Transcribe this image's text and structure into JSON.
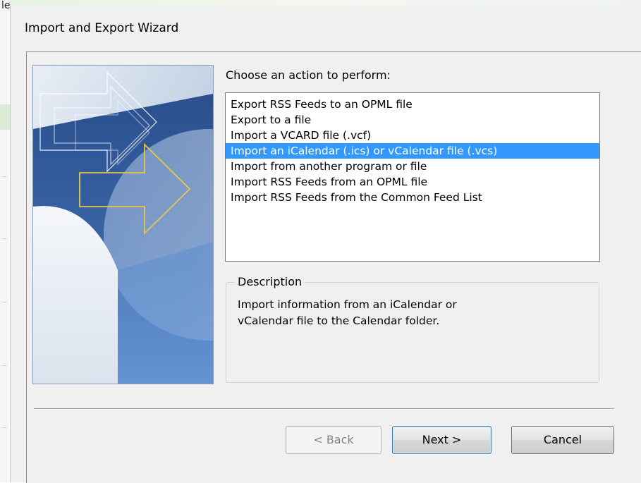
{
  "background_app": {
    "title_fragment": "le"
  },
  "dialog": {
    "title": "Import and Export Wizard",
    "prompt": "Choose an action to perform:",
    "actions": [
      {
        "label": "Export RSS Feeds to an OPML file",
        "selected": false
      },
      {
        "label": "Export to a file",
        "selected": false
      },
      {
        "label": "Import a VCARD file (.vcf)",
        "selected": false
      },
      {
        "label": "Import an iCalendar (.ics) or vCalendar file (.vcs)",
        "selected": true
      },
      {
        "label": "Import from another program or file",
        "selected": false
      },
      {
        "label": "Import RSS Feeds from an OPML file",
        "selected": false
      },
      {
        "label": "Import RSS Feeds from the Common Feed List",
        "selected": false
      }
    ],
    "description": {
      "legend": "Description",
      "text_line1": "Import information from an iCalendar or",
      "text_line2": "vCalendar file to the Calendar folder."
    },
    "buttons": {
      "back": "< Back",
      "next": "Next >",
      "cancel": "Cancel"
    }
  },
  "colors": {
    "selection": "#3399ff",
    "dialog_bg": "#f0f0f0",
    "art_arrow_accent": "#e6c84a"
  },
  "icons": {
    "wizard_art": "wizard-arrows-illustration-icon"
  }
}
